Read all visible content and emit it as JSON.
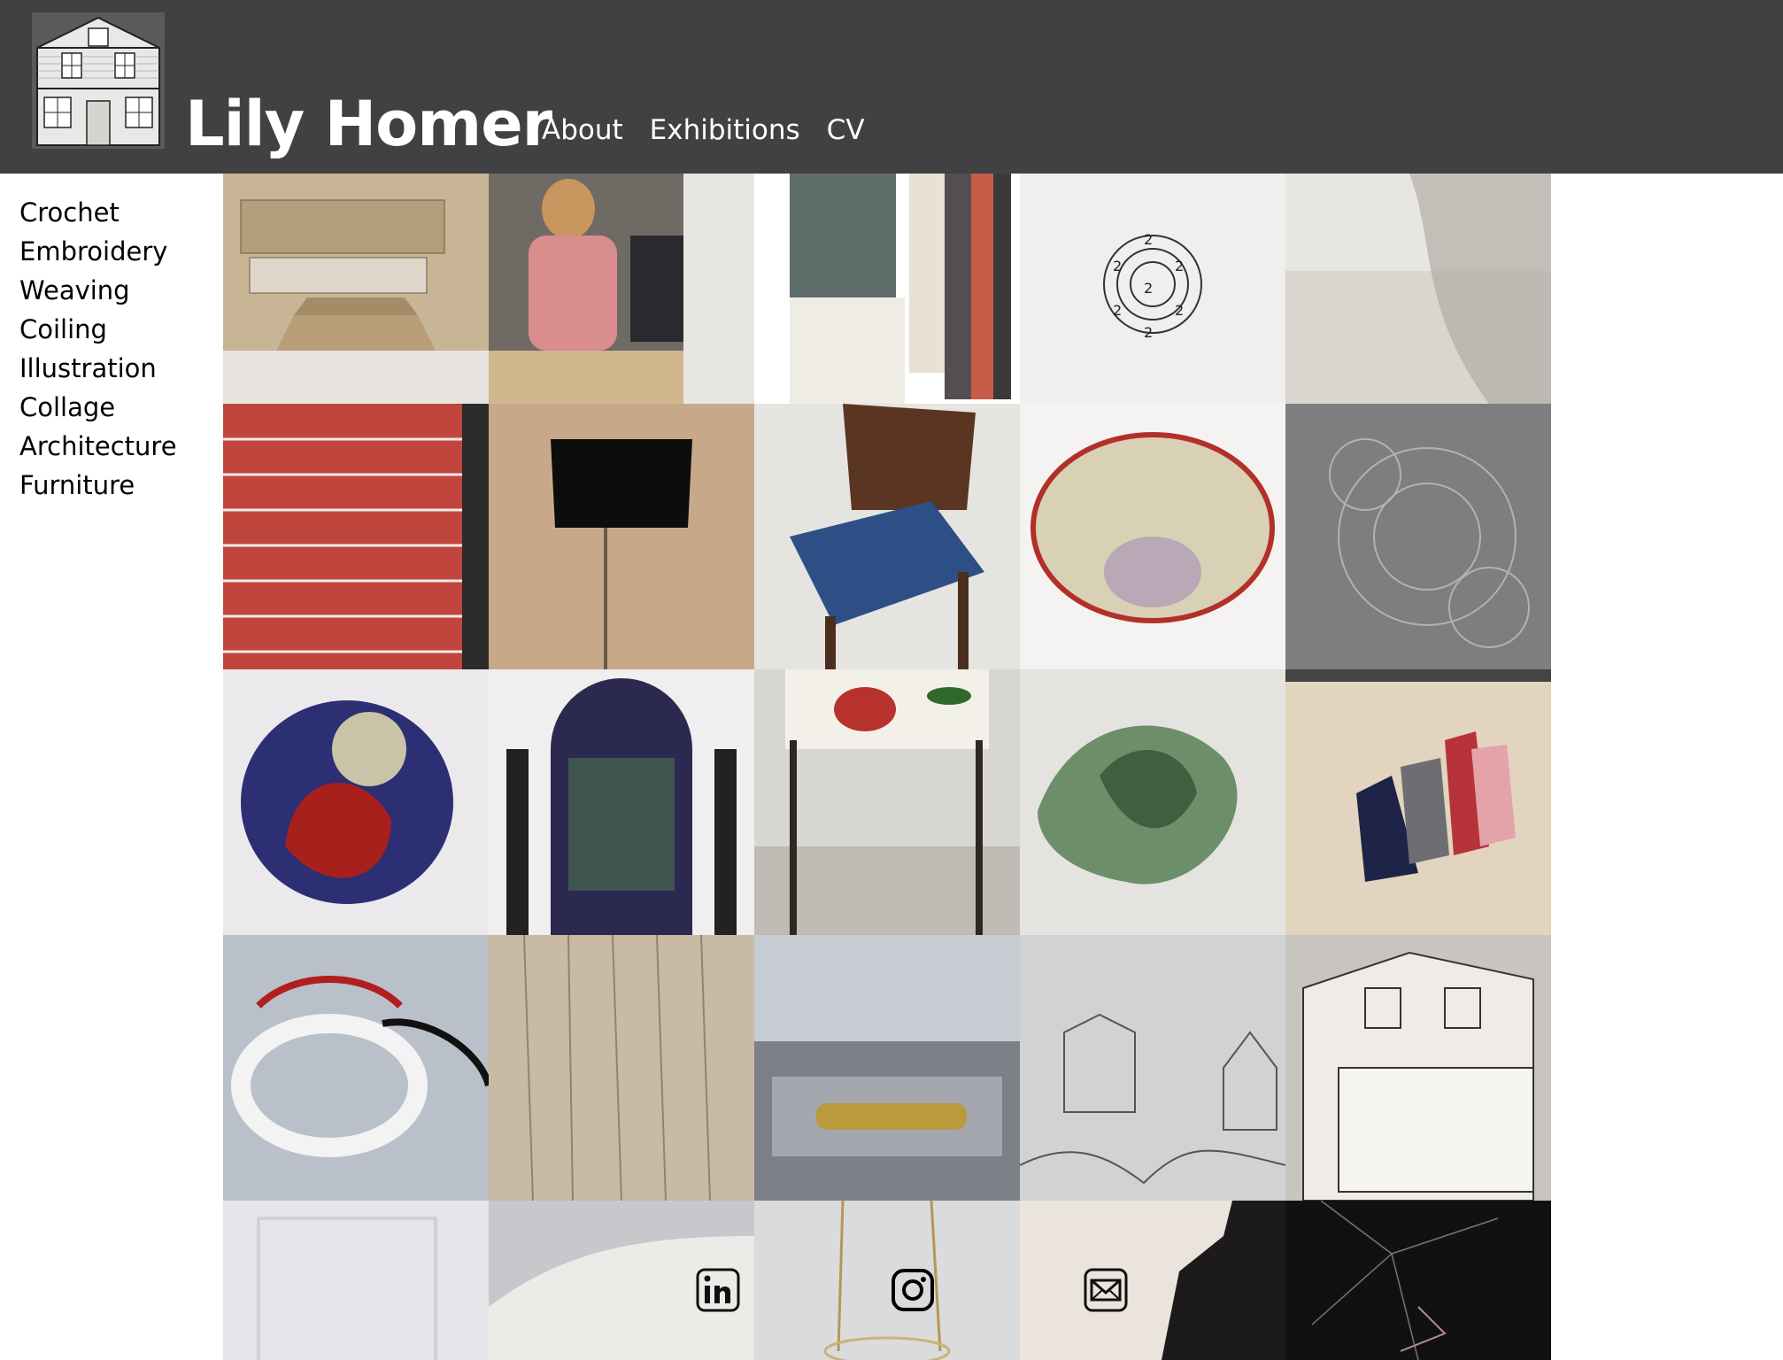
{
  "header": {
    "site_title": "Lily Homer",
    "logo_icon": "house-drawing-logo",
    "nav": [
      {
        "label": "About"
      },
      {
        "label": "Exhibitions"
      },
      {
        "label": "CV"
      }
    ]
  },
  "sidebar": {
    "items": [
      {
        "label": "Crochet"
      },
      {
        "label": "Embroidery"
      },
      {
        "label": "Weaving"
      },
      {
        "label": "Coiling"
      },
      {
        "label": "Illustration"
      },
      {
        "label": "Collage"
      },
      {
        "label": "Architecture"
      },
      {
        "label": "Furniture"
      }
    ]
  },
  "gallery": {
    "rows": 5,
    "columns": 5,
    "tiles": [
      "architectural-model",
      "woman-in-window",
      "book-spines",
      "embroidered-2-pattern",
      "sheer-mesh-fabric",
      "red-white-weaving",
      "scissors-on-cushion",
      "woven-blue-chair",
      "crochet-wire-basket",
      "grey-knit-mesh",
      "embroidered-rooster",
      "embroidered-doorway",
      "floral-stool",
      "green-embroidery",
      "abstract-embroidery",
      "white-red-coiled-bowl",
      "pleated-fabric",
      "gold-thread-handle",
      "house-sketches",
      "house-drawing",
      "white-wall-panel",
      "paper-lace",
      "gold-hanging-chain",
      "white-paper-collage",
      "black-stitched-web"
    ]
  },
  "social": {
    "icons": [
      "linkedin-icon",
      "instagram-icon",
      "email-icon"
    ]
  },
  "colors": {
    "header_bg": "#414042",
    "header_text": "#ffffff",
    "sidebar_text": "#000000"
  }
}
